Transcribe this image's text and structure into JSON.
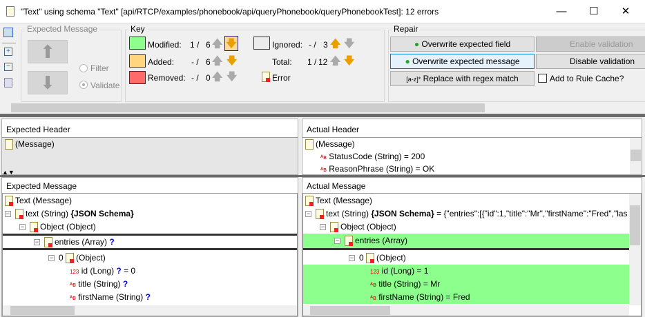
{
  "window": {
    "title": "\"Text\" using schema \"Text\" [api/RTCP/examples/phonebook/api/queryPhonebook/queryPhonebookTest]: 12 errors",
    "minimize": "—",
    "maximize": "☐",
    "close": "✕"
  },
  "expected_message_group": {
    "label": "Expected Message",
    "filter": "Filter",
    "validate": "Validate",
    "validate_selected": true
  },
  "key": {
    "label": "Key",
    "modified": {
      "label": "Modified:",
      "current": "1 /",
      "total": "6",
      "color": "#8cff8c"
    },
    "added": {
      "label": "Added:",
      "current": "- /",
      "total": "6",
      "color": "#ffd580"
    },
    "removed": {
      "label": "Removed:",
      "current": "- /",
      "total": "0",
      "color": "#ff6b6b"
    },
    "ignored": {
      "label": "Ignored:",
      "current": "- /",
      "total": "3",
      "color": "#ececec"
    },
    "total": {
      "label": "Total:",
      "current": "1 /",
      "total": "12"
    },
    "error": "Error"
  },
  "repair": {
    "label": "Repair",
    "overwrite_field": "Overwrite expected field",
    "overwrite_message": "Overwrite expected message",
    "regex": "Replace with regex match",
    "regex_icon": "[a-z]*",
    "enable_validation": "Enable validation",
    "disable_validation": "Disable validation",
    "add_to_cache": "Add to Rule Cache?"
  },
  "expected_header": {
    "title": "Expected Header",
    "root": "(Message)"
  },
  "actual_header": {
    "title": "Actual Header",
    "root": "(Message)",
    "items": [
      "StatusCode (String) = 200",
      "ReasonPhrase (String) = OK"
    ]
  },
  "expected_message": {
    "title": "Expected Message",
    "rows": [
      {
        "text": "Text (Message)"
      },
      {
        "text": "text (String) ",
        "bold": "{JSON Schema}"
      },
      {
        "text": "Object (Object)"
      },
      {
        "text": "entries (Array) ",
        "q": "?"
      },
      {
        "text": "0 ",
        "text2": "(Object)"
      },
      {
        "text": "id (Long) ",
        "q": "?",
        "after": " = 0"
      },
      {
        "text": "title (String) ",
        "q": "?"
      },
      {
        "text": "firstName (String) ",
        "q": "?"
      }
    ]
  },
  "actual_message": {
    "title": "Actual Message",
    "rows": [
      {
        "text": "Text (Message)"
      },
      {
        "text": "text (String) ",
        "bold": "{JSON Schema}",
        "after": " = {\"entries\":[{\"id\":1,\"title\":\"Mr\",\"firstName\":\"Fred\",\"las"
      },
      {
        "text": "Object (Object)"
      },
      {
        "text": "entries (Array)"
      },
      {
        "text": "0 ",
        "text2": "(Object)"
      },
      {
        "text": "id (Long) = 1"
      },
      {
        "text": "title (String) = Mr"
      },
      {
        "text": "firstName (String) = Fred"
      }
    ]
  }
}
